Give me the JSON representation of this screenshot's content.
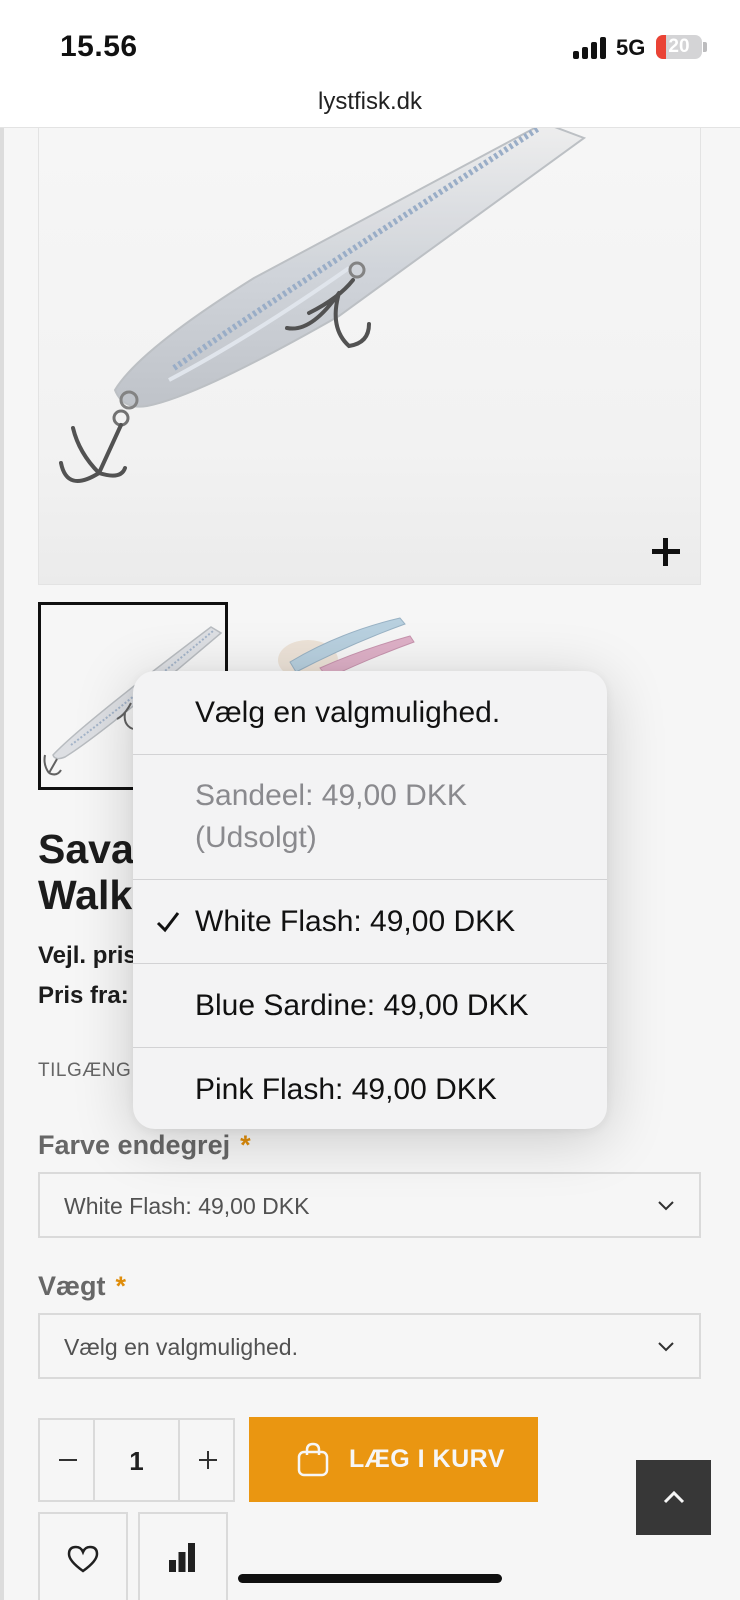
{
  "status_bar": {
    "time": "15.56",
    "network": "5G",
    "battery": "20"
  },
  "browser": {
    "url": "lystfisk.dk"
  },
  "product": {
    "title_line1": "Sava",
    "title_line2": "Walk",
    "price_label": "Vejl. pris",
    "price_from_label": "Pris fra:",
    "availability_label": "TILGÆNG"
  },
  "options": {
    "color": {
      "label": "Farve endegrej",
      "required_mark": "*",
      "value": "White Flash: 49,00 DKK"
    },
    "weight": {
      "label": "Vægt",
      "required_mark": "*",
      "value": "Vælg en valgmulighed."
    }
  },
  "cart": {
    "quantity": "1",
    "add_label": "LÆG I KURV"
  },
  "dropdown": {
    "items": [
      {
        "label": "Vælg en valgmulighed.",
        "selected": false,
        "disabled": false
      },
      {
        "label_line1": "Sandeel: 49,00 DKK",
        "label_line2": "(Udsolgt)",
        "selected": false,
        "disabled": true
      },
      {
        "label": "White Flash: 49,00 DKK",
        "selected": true,
        "disabled": false
      },
      {
        "label": "Blue Sardine: 49,00 DKK",
        "selected": false,
        "disabled": false
      },
      {
        "label": "Pink Flash: 49,00 DKK",
        "selected": false,
        "disabled": false
      }
    ]
  },
  "colors": {
    "accent": "#f39c12",
    "required": "#e8930c",
    "back_to_top_bg": "#3a3a3a"
  },
  "icons": {
    "zoom": "plus-icon",
    "chevron": "chevron-down-icon",
    "bag": "shopping-bag-icon",
    "wishlist": "heart-icon",
    "compare": "bar-chart-icon",
    "back_to_top": "chevron-up-icon",
    "selected": "checkmark-icon"
  }
}
